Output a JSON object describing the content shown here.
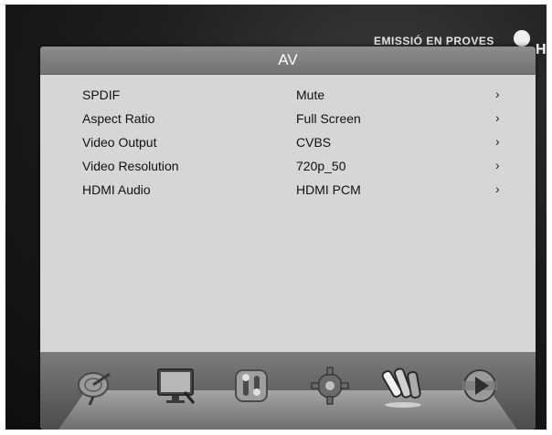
{
  "window": {
    "title": "AV"
  },
  "background": {
    "banner_text": "EMISSIÓ EN PROVES",
    "hd_label": "HD"
  },
  "settings": [
    {
      "label": "SPDIF",
      "value": "Mute",
      "arrow": "›"
    },
    {
      "label": "Aspect Ratio",
      "value": "Full Screen",
      "arrow": "›"
    },
    {
      "label": "Video Output",
      "value": "CVBS",
      "arrow": "›"
    },
    {
      "label": "Video Resolution",
      "value": "720p_50",
      "arrow": "›"
    },
    {
      "label": "HDMI Audio",
      "value": "HDMI PCM",
      "arrow": "›"
    }
  ],
  "dock": {
    "items": [
      {
        "icon": "satellite-dish-icon"
      },
      {
        "icon": "tv-monitor-icon"
      },
      {
        "icon": "tools-icon"
      },
      {
        "icon": "gear-icon"
      },
      {
        "icon": "av-cables-icon",
        "selected": true
      },
      {
        "icon": "media-play-icon"
      }
    ]
  }
}
